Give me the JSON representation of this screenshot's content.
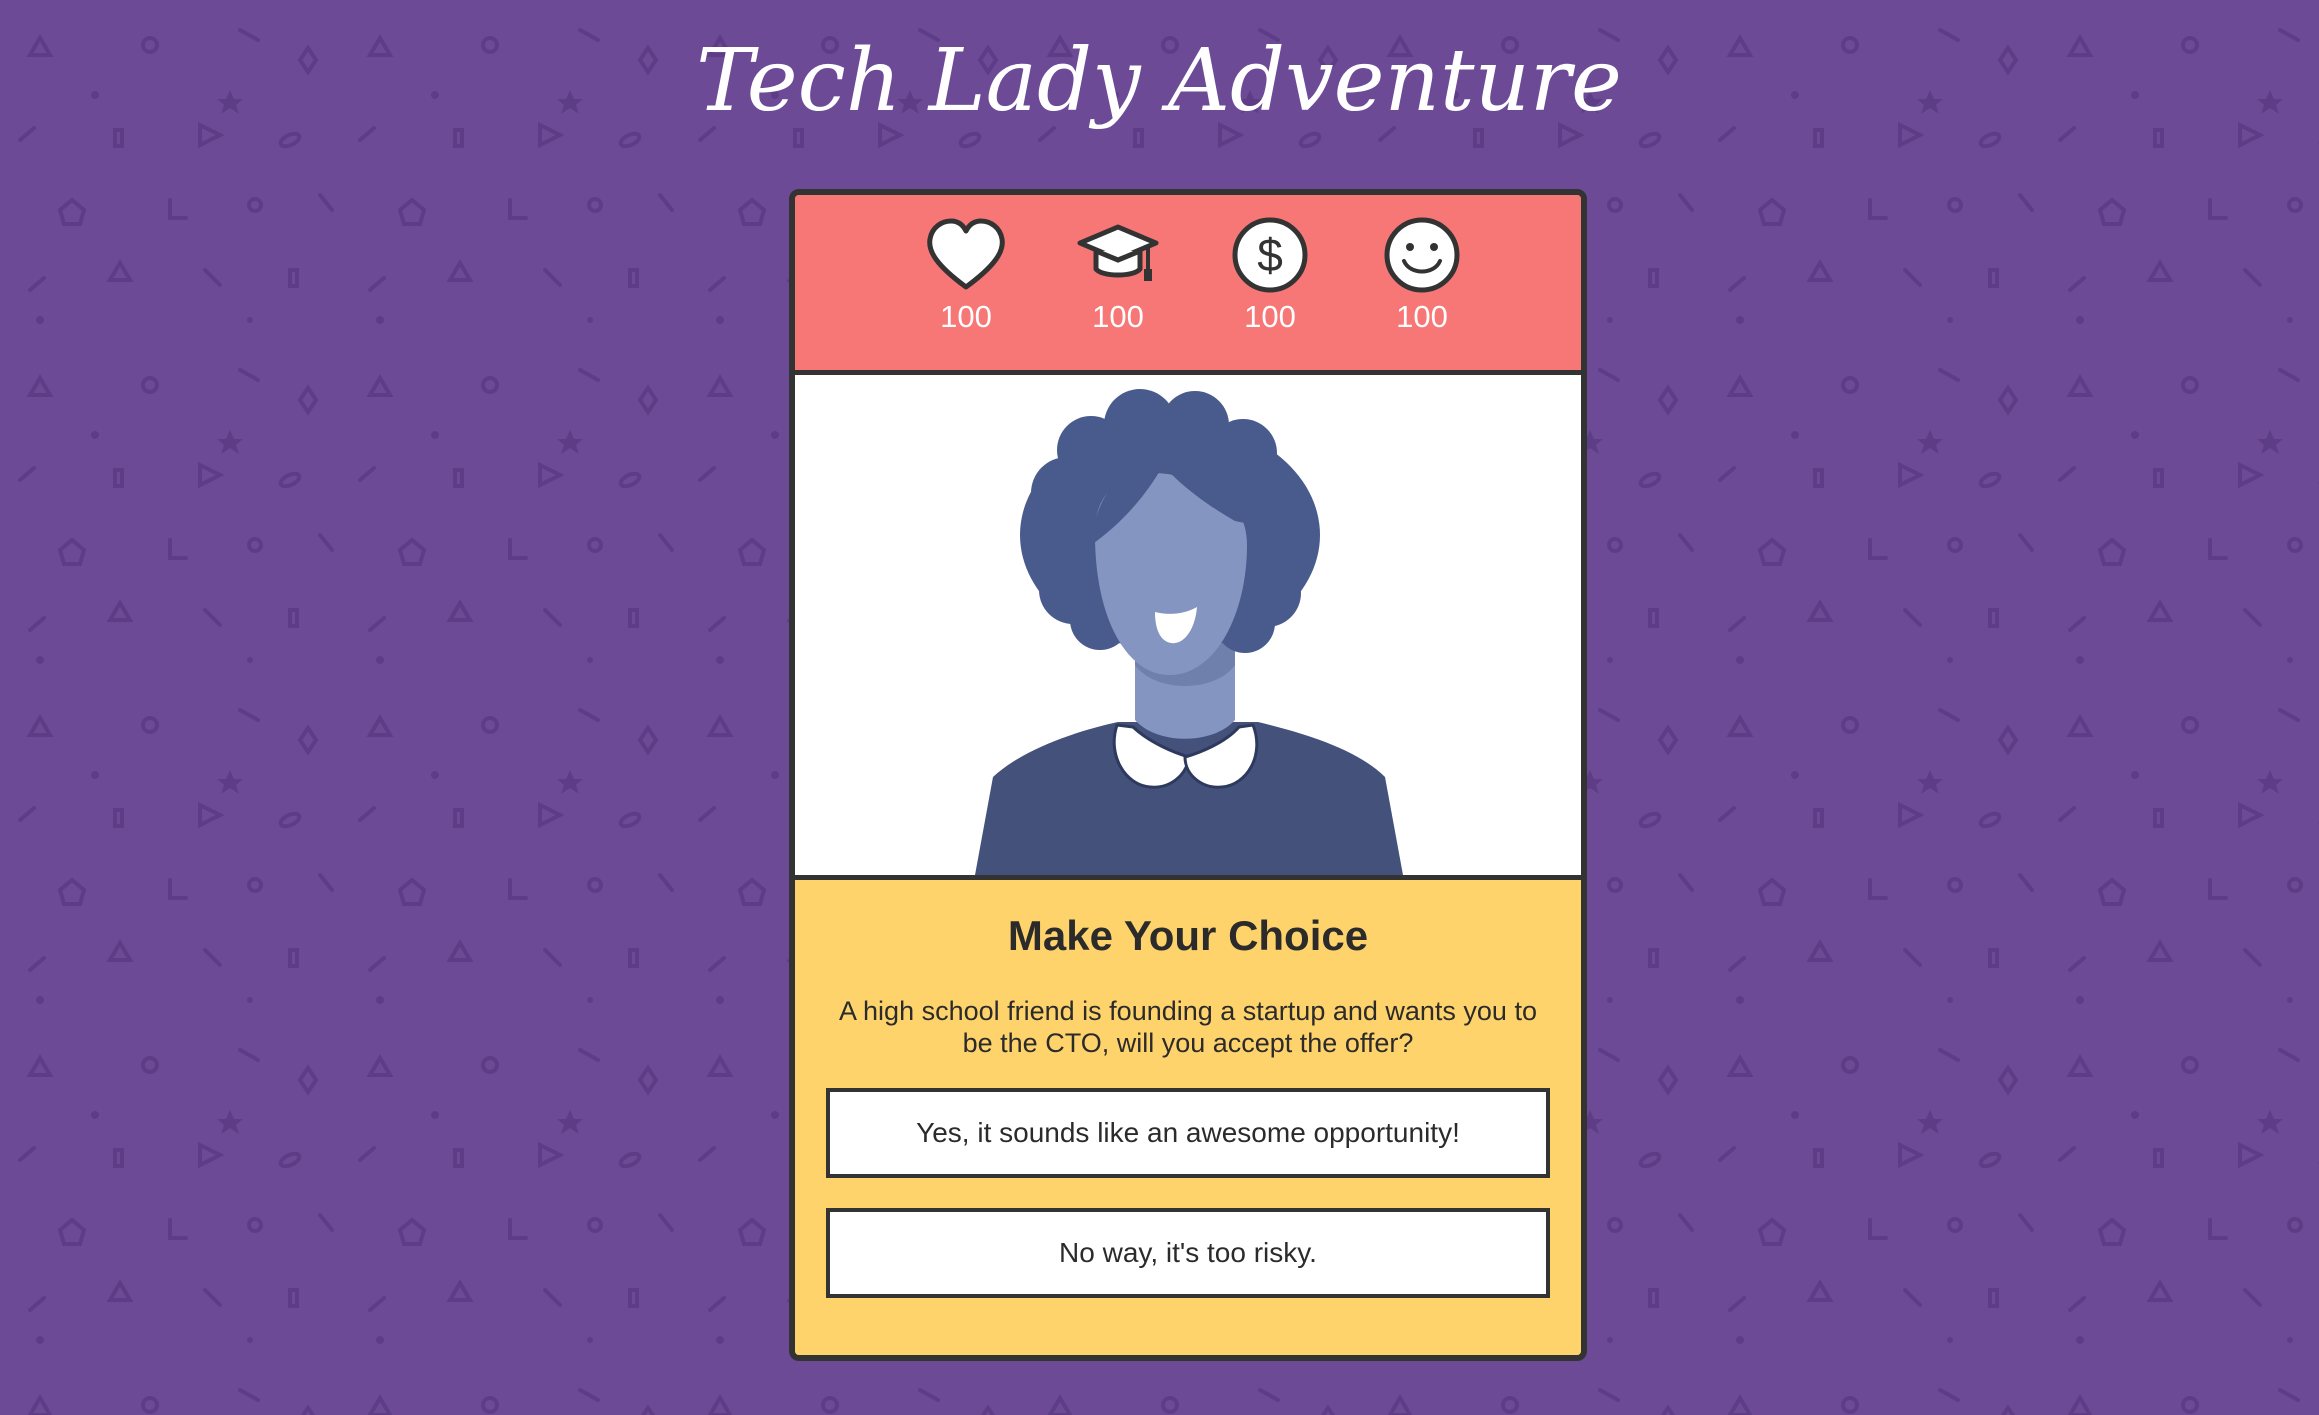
{
  "app": {
    "title": "Tech Lady Adventure"
  },
  "colors": {
    "background": "#6c4a96",
    "stats_bar": "#f77777",
    "choice_panel": "#ffd36c",
    "border": "#333333"
  },
  "stats": [
    {
      "name": "health",
      "icon": "heart-icon",
      "value": "100"
    },
    {
      "name": "education",
      "icon": "graduation-cap-icon",
      "value": "100"
    },
    {
      "name": "money",
      "icon": "dollar-icon",
      "value": "100"
    },
    {
      "name": "happiness",
      "icon": "smiley-icon",
      "value": "100"
    }
  ],
  "portrait": {
    "icon": "woman-portrait-illustration"
  },
  "choice": {
    "title": "Make Your Choice",
    "prompt": "A high school friend is founding a startup and wants you to be the CTO, will you accept the offer?",
    "options": [
      "Yes, it sounds like an awesome opportunity!",
      "No way, it's too risky."
    ]
  }
}
